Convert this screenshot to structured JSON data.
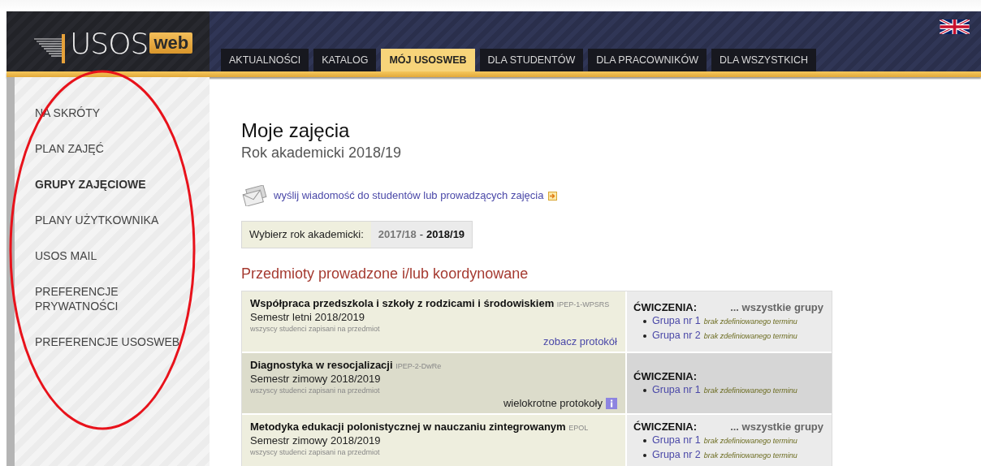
{
  "header": {
    "logo": {
      "text": "USOS",
      "badge": "web"
    },
    "tabs": [
      {
        "label": "AKTUALNOŚCI",
        "selected": false
      },
      {
        "label": "KATALOG",
        "selected": false
      },
      {
        "label": "MÓJ USOSWEB",
        "selected": true
      },
      {
        "label": "DLA STUDENTÓW",
        "selected": false
      },
      {
        "label": "DLA PRACOWNIKÓW",
        "selected": false
      },
      {
        "label": "DLA WSZYSTKICH",
        "selected": false
      }
    ]
  },
  "sidebar": {
    "items": [
      {
        "label": "NA SKRÓTY",
        "selected": false
      },
      {
        "label": "PLAN ZAJĘĆ",
        "selected": false
      },
      {
        "label": "GRUPY ZAJĘCIOWE",
        "selected": true
      },
      {
        "label": "PLANY UŻYTKOWNIKA",
        "selected": false
      },
      {
        "label": "USOS MAIL",
        "selected": false
      },
      {
        "label": "PREFERENCJE PRYWATNOŚCI",
        "selected": false
      },
      {
        "label": "PREFERENCJE USOSWEB",
        "selected": false
      }
    ]
  },
  "annotation": {
    "color": "#e8121b"
  },
  "page": {
    "title": "Moje zajęcia",
    "subtitle": "Rok akademicki 2018/19",
    "message_link": "wyślij wiadomość do studentów lub prowadzących zajęcia",
    "year_selector": {
      "label": "Wybierz rok akademicki:",
      "separator": "-",
      "years": [
        {
          "label": "2017/18",
          "selected": false
        },
        {
          "label": "2018/19",
          "selected": true
        }
      ]
    },
    "section_title": "Przedmioty prowadzone i/lub koordynowane",
    "courses": [
      {
        "name": "Współpraca przedszkola i szkoły z rodzicami i środowiskiem",
        "code": "IPEP-1-WPSRS",
        "semester": "Semestr letni 2018/2019",
        "audience": "wszyscy studenci zapisani na przedmiot",
        "action": {
          "kind": "link",
          "label": "zobacz protokół"
        },
        "highlighted": false,
        "groups_label": "ĆWICZENIA:",
        "all_groups": "... wszystkie grupy",
        "groups": [
          {
            "label": "Grupa nr 1",
            "note": "brak zdefiniowanego terminu"
          },
          {
            "label": "Grupa nr 2",
            "note": "brak zdefiniowanego terminu"
          }
        ]
      },
      {
        "name": "Diagnostyka w resocjalizacji",
        "code": "IPEP-2-DwRe",
        "semester": "Semestr zimowy 2018/2019",
        "audience": "wszyscy studenci zapisani na przedmiot",
        "action": {
          "kind": "info",
          "label": "wielokrotne protokoły"
        },
        "highlighted": true,
        "groups_label": "ĆWICZENIA:",
        "groups": [
          {
            "label": "Grupa nr 1",
            "note": "brak zdefiniowanego terminu"
          }
        ]
      },
      {
        "name": "Metodyka edukacji polonistycznej w nauczaniu zintegrowanym",
        "code": "EPOL",
        "semester": "Semestr zimowy 2018/2019",
        "audience": "wszyscy studenci zapisani na przedmiot",
        "highlighted": false,
        "groups_label": "ĆWICZENIA:",
        "all_groups": "... wszystkie grupy",
        "groups": [
          {
            "label": "Grupa nr 1",
            "note": "brak zdefiniowanego terminu"
          },
          {
            "label": "Grupa nr 2",
            "note": "brak zdefiniowanego terminu"
          }
        ]
      }
    ]
  }
}
